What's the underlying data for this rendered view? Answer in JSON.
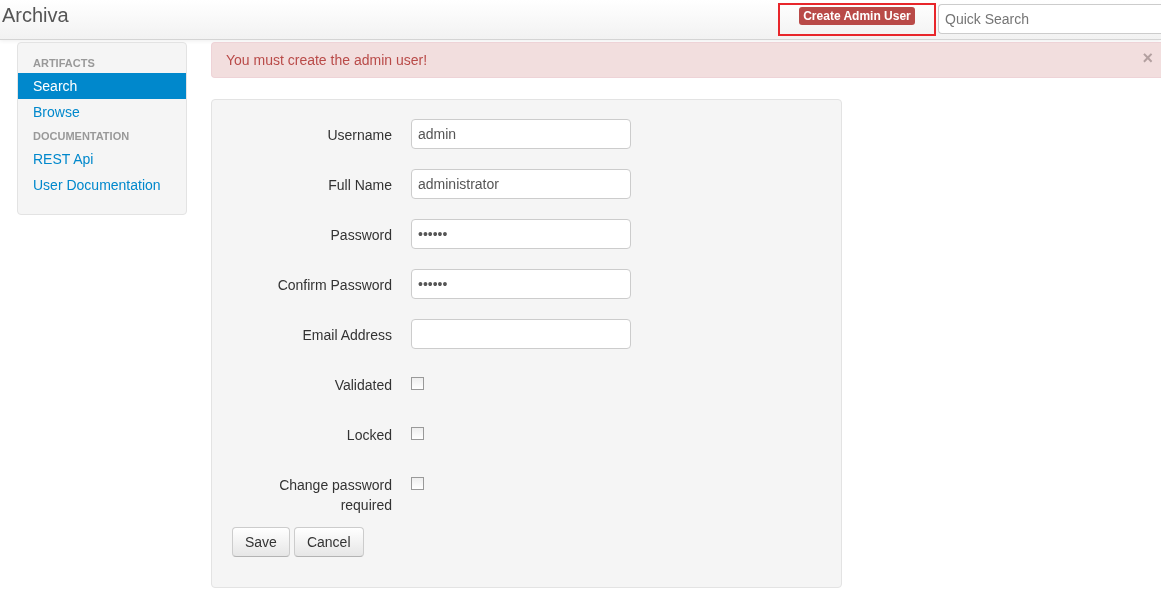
{
  "navbar": {
    "brand": "Archiva",
    "badge": "Create Admin User",
    "search": {
      "placeholder": "Quick Search"
    }
  },
  "sidebar": {
    "items": [
      {
        "kind": "header",
        "label": "ARTIFACTS"
      },
      {
        "kind": "link",
        "label": "Search",
        "selected": true
      },
      {
        "kind": "link",
        "label": "Browse",
        "selected": false
      },
      {
        "kind": "header",
        "label": "DOCUMENTATION"
      },
      {
        "kind": "link",
        "label": "REST Api",
        "selected": false
      },
      {
        "kind": "link",
        "label": "User Documentation",
        "selected": false
      }
    ]
  },
  "alert": {
    "message": "You must create the admin user!",
    "close": "×"
  },
  "form": {
    "fields": [
      {
        "kind": "text",
        "label": "Username",
        "value": "admin"
      },
      {
        "kind": "text",
        "label": "Full Name",
        "value": "administrator"
      },
      {
        "kind": "text",
        "label": "Password",
        "value": "••••••"
      },
      {
        "kind": "text",
        "label": "Confirm Password",
        "value": "••••••"
      },
      {
        "kind": "text",
        "label": "Email Address"
      },
      {
        "kind": "checkbox",
        "label": "Validated",
        "checked": false
      },
      {
        "kind": "checkbox",
        "label": "Locked",
        "checked": false
      },
      {
        "kind": "checkbox",
        "label": "Change password required",
        "checked": false
      }
    ],
    "buttons": [
      "Save",
      "Cancel"
    ]
  }
}
